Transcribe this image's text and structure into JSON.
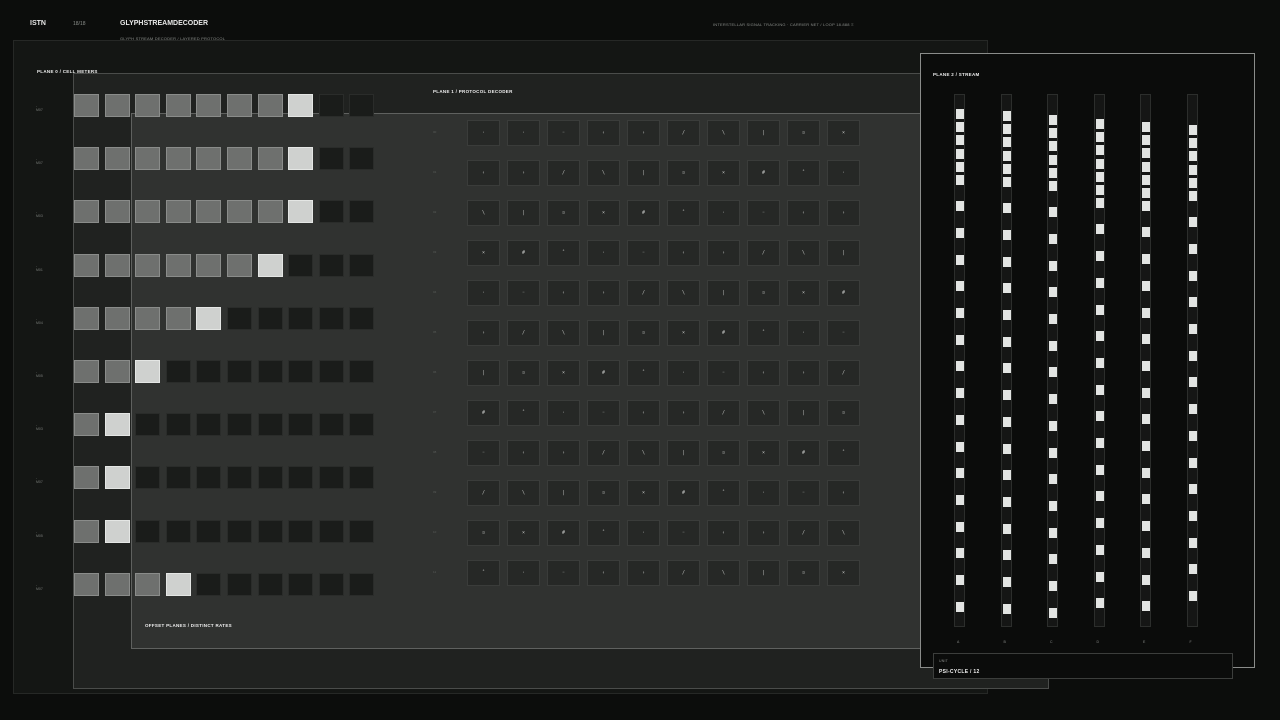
{
  "header": {
    "brand": "ISTN",
    "counter": "18/18",
    "title": "GLYPHSTREAMDECODER",
    "subtitle": "GLYPH STREAM DECODER  /  LAYERED PROTOCOL",
    "right_status": "INTERSTELLAR SIGNAL TRACKING · CARRIER NET  /  LOOP 18.888 Ξ"
  },
  "plane0": {
    "label": "PLANE 0  /  CELL METERS",
    "rows": [
      {
        "label": "- M07",
        "level": 8,
        "total": 10
      },
      {
        "label": "- M07",
        "level": 8,
        "total": 10
      },
      {
        "label": "- M03",
        "level": 8,
        "total": 10
      },
      {
        "label": "- M01",
        "level": 7,
        "total": 10
      },
      {
        "label": "- M04",
        "level": 5,
        "total": 10
      },
      {
        "label": "- M05",
        "level": 3,
        "total": 10
      },
      {
        "label": "- M03",
        "level": 2,
        "total": 10
      },
      {
        "label": "- M07",
        "level": 2,
        "total": 10
      },
      {
        "label": "- M05",
        "level": 2,
        "total": 10
      },
      {
        "label": "- M07",
        "level": 4,
        "total": 10
      }
    ]
  },
  "plane1": {
    "label": "PLANE 1  /  PROTOCOL DECODER",
    "footnote": "OFFSET PLANES  /  DISTINCT RATES",
    "row_indices": [
      "00",
      "01",
      "02",
      "03",
      "04",
      "05",
      "06",
      "07",
      "08",
      "09",
      "10",
      "11"
    ],
    "grid": [
      [
        "·",
        "·",
        "◦",
        "‹",
        "›",
        "/",
        "\\",
        "|",
        "¤",
        "×"
      ],
      [
        "‹",
        "›",
        "/",
        "\\",
        "|",
        "¤",
        "×",
        "#",
        "˚",
        "·"
      ],
      [
        "\\",
        "|",
        "¤",
        "×",
        "#",
        "˚",
        "·",
        "◦",
        "‹",
        "›"
      ],
      [
        "×",
        "#",
        "˚",
        "·",
        "◦",
        "‹",
        "›",
        "/",
        "\\",
        "|"
      ],
      [
        "·",
        "◦",
        "‹",
        "›",
        "/",
        "\\",
        "|",
        "¤",
        "×",
        "#"
      ],
      [
        "›",
        "/",
        "\\",
        "|",
        "¤",
        "×",
        "#",
        "˚",
        "·",
        "◦"
      ],
      [
        "|",
        "¤",
        "×",
        "#",
        "˚",
        "·",
        "◦",
        "‹",
        "›",
        "/"
      ],
      [
        "#",
        "˚",
        "·",
        "◦",
        "‹",
        "›",
        "/",
        "\\",
        "|",
        "¤"
      ],
      [
        "◦",
        "‹",
        "›",
        "/",
        "\\",
        "|",
        "¤",
        "×",
        "#",
        "˚"
      ],
      [
        "/",
        "\\",
        "|",
        "¤",
        "×",
        "#",
        "˚",
        "·",
        "◦",
        "‹"
      ],
      [
        "¤",
        "×",
        "#",
        "˚",
        "·",
        "◦",
        "‹",
        "›",
        "/",
        "\\"
      ],
      [
        "˚",
        "·",
        "◦",
        "‹",
        "›",
        "/",
        "\\",
        "|",
        "¤",
        "×"
      ]
    ]
  },
  "plane2": {
    "label": "PLANE 2  /  STREAM",
    "tracks": [
      {
        "label": "A",
        "dense": 6,
        "offset": 0
      },
      {
        "label": "B",
        "dense": 6,
        "offset": 2
      },
      {
        "label": "C",
        "dense": 6,
        "offset": 6
      },
      {
        "label": "D",
        "dense": 7,
        "offset": 10
      },
      {
        "label": "E",
        "dense": 7,
        "offset": 13
      },
      {
        "label": "F",
        "dense": 6,
        "offset": 16
      }
    ],
    "footer_small": "UNIT",
    "footer_main": "PSI-CYCLE / 12"
  },
  "colors": {
    "background": "#0c0d0c",
    "meter_on": "#6e706e",
    "meter_peak": "#cfd1cf",
    "meter_off": "#1a1c1a",
    "tick": "#e2e4e2"
  }
}
